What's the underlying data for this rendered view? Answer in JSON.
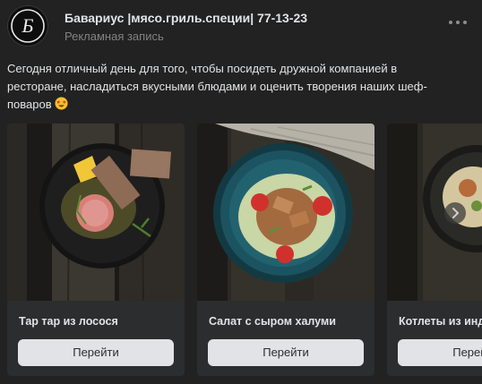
{
  "post": {
    "author": "Бавариус |мясо.гриль.специи| 77-13-23",
    "subtitle": "Рекламная запись",
    "text": "Сегодня отличный день для того, чтобы посидеть дружной компанией в ресторане, насладиться вкусными блюдами и оценить творения наших шеф-поваров",
    "emoji_icon": "star-struck-emoji-icon",
    "logo_letter": "Б"
  },
  "carousel": {
    "cards": [
      {
        "title": "Тар тар из лосося",
        "button_label": "Перейти"
      },
      {
        "title": "Салат с сыром халуми",
        "button_label": "Перейти"
      },
      {
        "title": "Котлеты из инд",
        "button_label": "Перейти"
      }
    ],
    "next_icon": "chevron-right-icon"
  },
  "colors": {
    "background": "#222222",
    "card": "#2c2d2e",
    "button": "#e1e3e6",
    "text": "#e1e3e6",
    "muted": "#828282"
  }
}
